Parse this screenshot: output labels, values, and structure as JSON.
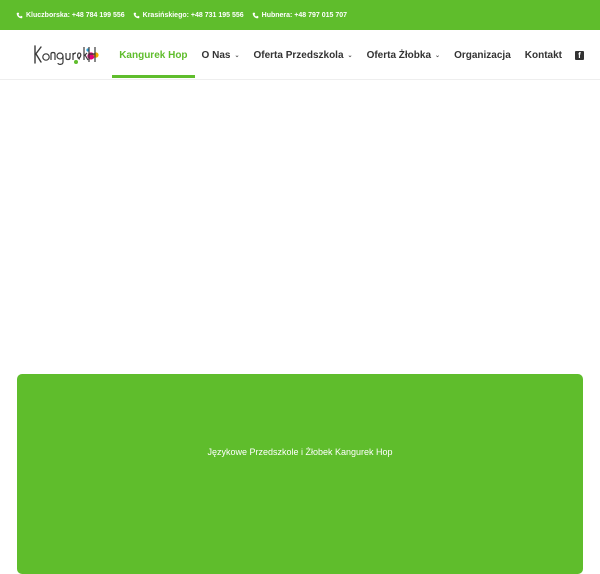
{
  "topbar": {
    "phones": [
      {
        "text": "Kluczborska: +48 784 199 556",
        "icon": "phone-icon"
      },
      {
        "text": "Krasińskiego: +48 731 195 556",
        "icon": "phone-icon"
      },
      {
        "text": "Hubnera: +48 797 015 707",
        "icon": "phone-icon"
      }
    ]
  },
  "logo": {
    "alt": "Kangurek Hop logo"
  },
  "nav": {
    "items": [
      {
        "label": "Kangurek Hop",
        "active": true
      },
      {
        "label": "O Nas",
        "dropdown": true
      },
      {
        "label": "Oferta Przedszkola",
        "dropdown": true
      },
      {
        "label": "Oferta Żłobka",
        "dropdown": true
      },
      {
        "label": "Organizacja"
      },
      {
        "label": "Kontakt"
      }
    ],
    "social": {
      "icon": "facebook-icon",
      "glyph": "f"
    },
    "caret": "⌄"
  },
  "hero": {
    "title": "Językowe Przedszkole i Żłobek Kangurek Hop"
  },
  "colors": {
    "brand_green": "#5fbd2c",
    "nav_text": "#333333",
    "white": "#ffffff"
  }
}
